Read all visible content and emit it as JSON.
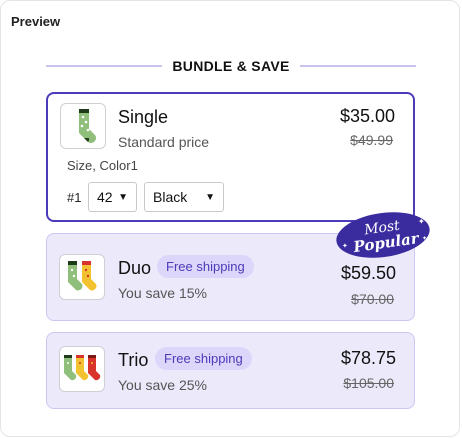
{
  "header": {
    "title": "Preview"
  },
  "bundle": {
    "heading": "BUNDLE & SAVE",
    "options": [
      {
        "title": "Single",
        "subtitle": "Standard price",
        "price": "$35.00",
        "compare_price": "$49.99",
        "variant_label": "Size, Color1",
        "row_number": "#1",
        "size_select": "42",
        "color_select": "Black",
        "selected": true
      },
      {
        "title": "Duo",
        "badge": "Free shipping",
        "subtitle": "You save 15%",
        "price": "$59.50",
        "compare_price": "$70.00",
        "selected": false
      },
      {
        "title": "Trio",
        "badge": "Free shipping",
        "subtitle": "You save 25%",
        "price": "$78.75",
        "compare_price": "$105.00",
        "selected": false
      }
    ],
    "popular_sticker": {
      "line1": "Most",
      "line2": "Popular"
    }
  },
  "colors": {
    "accent": "#4b3bb8",
    "card_bg": "#ece9fb",
    "badge_bg": "#ddd6fb",
    "divider": "#c9c3ef"
  }
}
